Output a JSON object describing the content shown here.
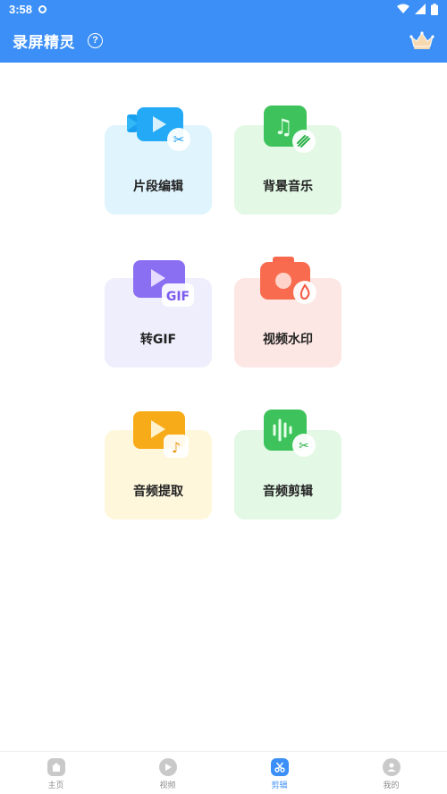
{
  "status": {
    "time": "3:58"
  },
  "app": {
    "title": "录屏精灵",
    "help_glyph": "?"
  },
  "tools": {
    "clip_edit": {
      "label": "片段编辑",
      "color": "#e0f4fd"
    },
    "bg_music": {
      "label": "背景音乐",
      "color": "#e3f8e5"
    },
    "to_gif": {
      "label": "转GIF",
      "color": "#efeefc",
      "badge": "GIF"
    },
    "watermark": {
      "label": "视频水印",
      "color": "#fde7e4"
    },
    "audio_extract": {
      "label": "音频提取",
      "color": "#fff7dc"
    },
    "audio_edit": {
      "label": "音频剪辑",
      "color": "#e3f8e5"
    }
  },
  "tabs": [
    {
      "label": "主页",
      "icon": "home-icon"
    },
    {
      "label": "视频",
      "icon": "play-icon"
    },
    {
      "label": "剪辑",
      "icon": "scissors-icon",
      "active": true
    },
    {
      "label": "我的",
      "icon": "user-icon"
    }
  ],
  "colors": {
    "primary": "#3b8ff6"
  }
}
